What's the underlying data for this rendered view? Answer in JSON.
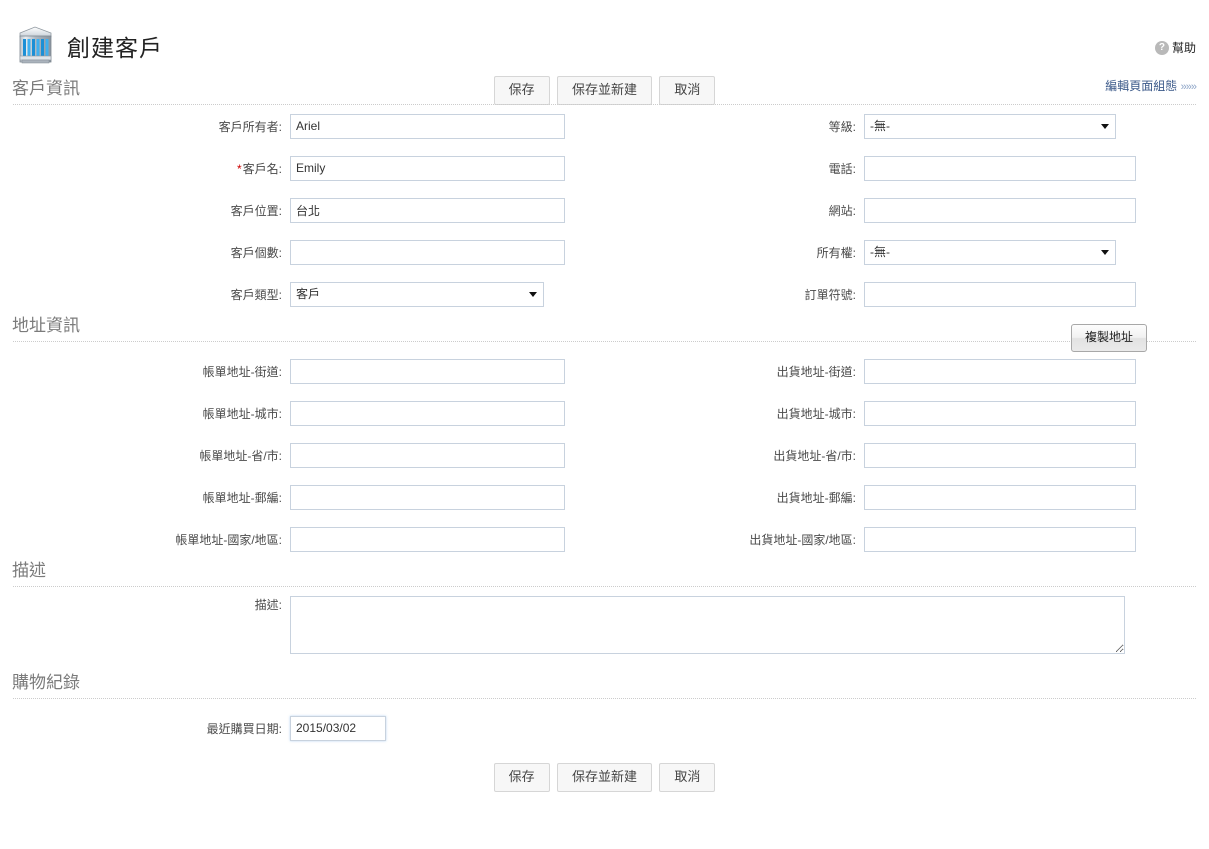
{
  "header": {
    "title": "創建客戶",
    "app_icon": "building-icon",
    "help_label": "幫助",
    "help_icon": "question-mark-icon",
    "edit_layout_label": "編輯頁面組態",
    "edit_layout_chevrons": "»»»"
  },
  "toolbar": {
    "save_label": "保存",
    "save_new_label": "保存並新建",
    "cancel_label": "取消"
  },
  "sections": {
    "account_info": {
      "title": "客戶資訊",
      "left": [
        {
          "label": "客戶所有者:",
          "value": "Ariel",
          "type": "text",
          "readonly": true,
          "required": false,
          "name": "account-owner"
        },
        {
          "label": "客戶名:",
          "value": "Emily",
          "type": "text",
          "readonly": false,
          "required": true,
          "name": "account-name"
        },
        {
          "label": "客戶位置:",
          "value": "台北",
          "type": "text",
          "readonly": false,
          "required": false,
          "name": "account-site"
        },
        {
          "label": "客戶個數:",
          "value": "",
          "type": "text",
          "readonly": false,
          "required": false,
          "name": "employee-count"
        },
        {
          "label": "客戶類型:",
          "value": "客户",
          "type": "select",
          "readonly": false,
          "required": false,
          "name": "account-type"
        }
      ],
      "right": [
        {
          "label": "等級:",
          "value": "-無-",
          "type": "select",
          "readonly": false,
          "required": false,
          "name": "rating"
        },
        {
          "label": "電話:",
          "value": "",
          "type": "text",
          "readonly": false,
          "required": false,
          "name": "phone"
        },
        {
          "label": "網站:",
          "value": "",
          "type": "text",
          "readonly": false,
          "required": false,
          "name": "website"
        },
        {
          "label": "所有權:",
          "value": "-無-",
          "type": "select",
          "readonly": false,
          "required": false,
          "name": "ownership"
        },
        {
          "label": "訂單符號:",
          "value": "",
          "type": "text",
          "readonly": false,
          "required": false,
          "name": "ticker-symbol"
        }
      ]
    },
    "address_info": {
      "title": "地址資訊",
      "copy_address_label": "複製地址",
      "left": [
        {
          "label": "帳單地址-街道:",
          "value": "",
          "type": "text",
          "name": "billing-street"
        },
        {
          "label": "帳單地址-城市:",
          "value": "",
          "type": "text",
          "name": "billing-city"
        },
        {
          "label": "帳單地址-省/市:",
          "value": "",
          "type": "text",
          "name": "billing-state"
        },
        {
          "label": "帳單地址-郵編:",
          "value": "",
          "type": "text",
          "name": "billing-zip"
        },
        {
          "label": "帳單地址-國家/地區:",
          "value": "",
          "type": "text",
          "name": "billing-country"
        }
      ],
      "right": [
        {
          "label": "出貨地址-街道:",
          "value": "",
          "type": "text",
          "name": "shipping-street"
        },
        {
          "label": "出貨地址-城市:",
          "value": "",
          "type": "text",
          "name": "shipping-city"
        },
        {
          "label": "出貨地址-省/市:",
          "value": "",
          "type": "text",
          "name": "shipping-state"
        },
        {
          "label": "出貨地址-郵編:",
          "value": "",
          "type": "text",
          "name": "shipping-zip"
        },
        {
          "label": "出貨地址-國家/地區:",
          "value": "",
          "type": "text",
          "name": "shipping-country"
        }
      ]
    },
    "description_info": {
      "title": "描述",
      "description_label": "描述:",
      "description_value": ""
    },
    "shopping_record": {
      "title": "購物紀錄",
      "date_label": "最近購買日期:",
      "date_value": "2015/03/02"
    }
  },
  "colors": {
    "link": "#3c5a8a",
    "required": "#cc0000",
    "section_title": "#7b7b7b",
    "field_border": "#c8d2de",
    "focus_border": "#7cb0e6"
  }
}
